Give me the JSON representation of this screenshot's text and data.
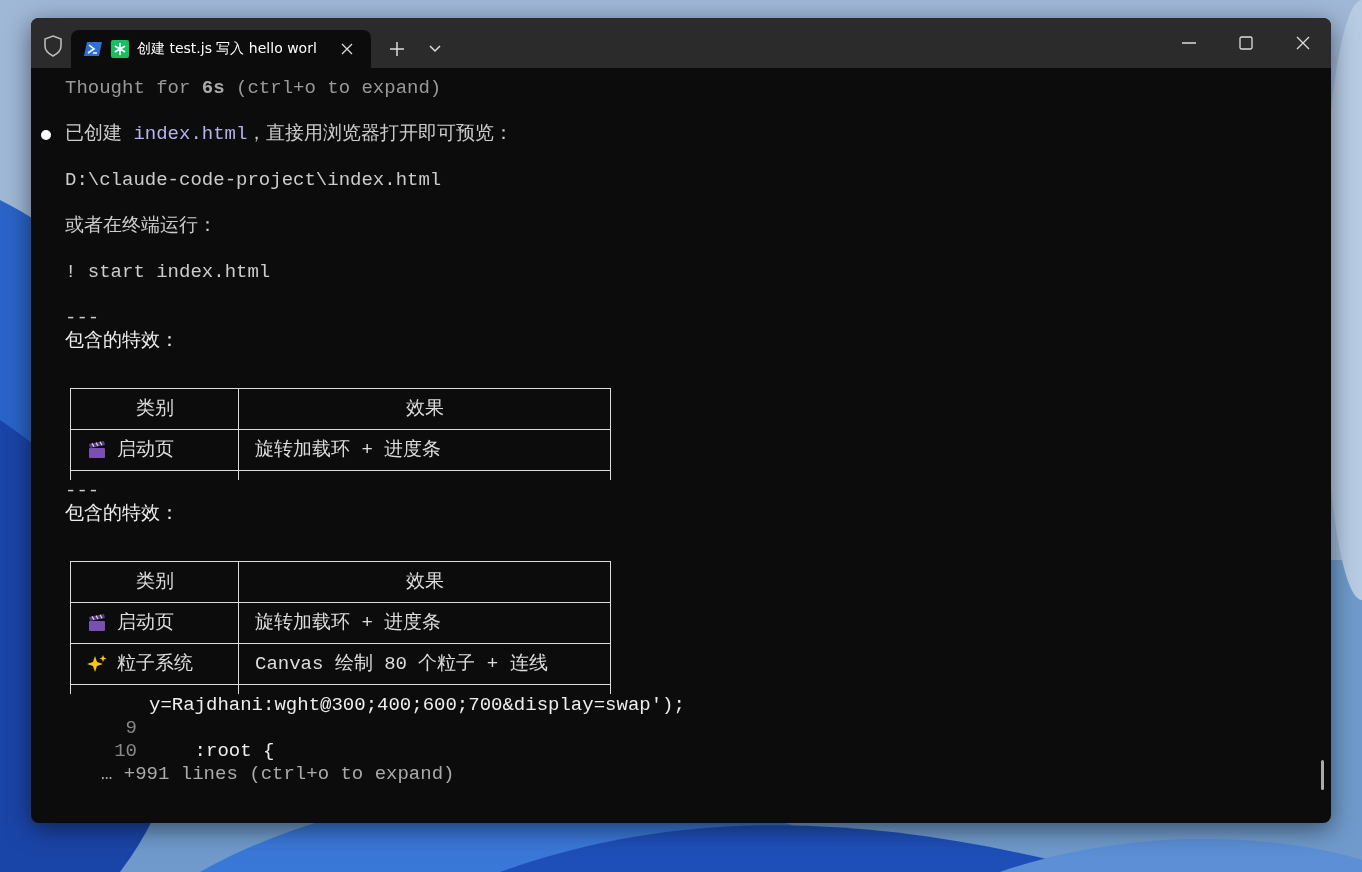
{
  "window": {
    "tabs": [
      {
        "title": "创建 test.js 写入 hello worl",
        "selected": true
      }
    ]
  },
  "blocks": [
    {
      "kind": "thought",
      "text": "Thought for **6s** (ctrl+o to expand)"
    },
    {
      "kind": "bullet",
      "parts": [
        {
          "text": "已创建 "
        },
        {
          "text": "index.html",
          "kind": "code"
        },
        {
          "text": "，直接用浏览器打开即可预览："
        }
      ]
    },
    {
      "kind": "text",
      "text": "D:\\claude-code-project\\index.html"
    },
    {
      "kind": "text",
      "text": "或者在终端运行："
    },
    {
      "kind": "text",
      "text": "! start index.html"
    },
    {
      "kind": "rule",
      "text": "---"
    },
    {
      "kind": "heading",
      "text": "包含的特效："
    },
    {
      "kind": "table",
      "truncated": true,
      "columns": [
        "类别",
        "效果"
      ],
      "rows": [
        {
          "kind": "clapper",
          "cells": [
            "启动页",
            "旋转加载环 + 进度条"
          ]
        }
      ]
    },
    {
      "kind": "rule",
      "text": "---"
    },
    {
      "kind": "heading",
      "text": "包含的特效："
    },
    {
      "kind": "table",
      "truncated": true,
      "columns": [
        "类别",
        "效果"
      ],
      "rows": [
        {
          "kind": "clapper",
          "cells": [
            "启动页",
            "旋转加载环 + 进度条"
          ]
        },
        {
          "kind": "sparkles",
          "cells": [
            "粒子系统",
            "Canvas 绘制 80 个粒子 + 连线"
          ]
        }
      ]
    },
    {
      "kind": "code",
      "text": "y=Rajdhani:wght@300;400;600;700&display=swap');"
    },
    {
      "kind": "code",
      "number": "9"
    },
    {
      "kind": "code",
      "number": "10",
      "text": "    :root {"
    },
    {
      "kind": "more",
      "text": "… +991 lines (ctrl+o to expand)"
    }
  ]
}
